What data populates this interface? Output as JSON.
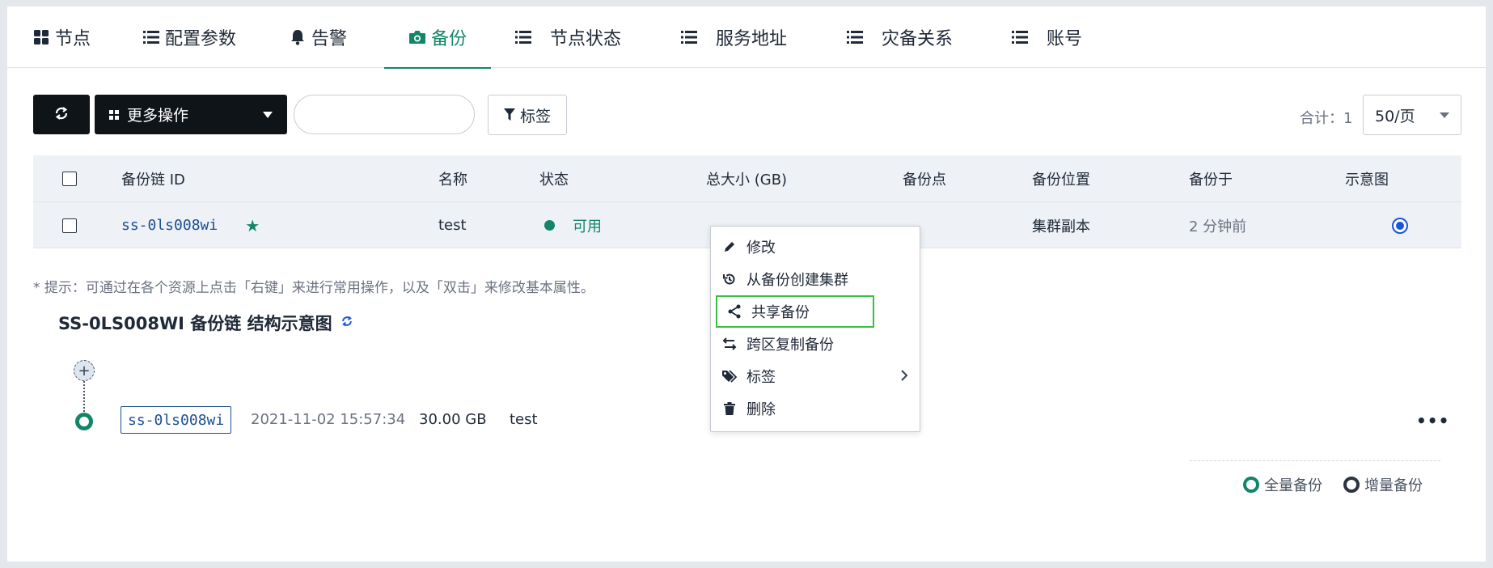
{
  "tabs": [
    {
      "label": "节点",
      "icon": "grid-icon"
    },
    {
      "label": "配置参数",
      "icon": "list-icon"
    },
    {
      "label": "告警",
      "icon": "bell-icon"
    },
    {
      "label": "备份",
      "icon": "camera-icon",
      "active": true
    },
    {
      "label": "节点状态",
      "icon": "list-icon"
    },
    {
      "label": "服务地址",
      "icon": "list-icon"
    },
    {
      "label": "灾备关系",
      "icon": "list-icon"
    },
    {
      "label": "账号",
      "icon": "list-icon"
    }
  ],
  "toolbar": {
    "more_actions_label": "更多操作",
    "search_placeholder": "",
    "tag_filter_label": "标签",
    "total_label": "合计：1",
    "page_size": "50/页"
  },
  "table": {
    "columns": [
      "备份链 ID",
      "名称",
      "状态",
      "总大小 (GB)",
      "备份点",
      "备份位置",
      "备份于",
      "示意图"
    ],
    "rows": [
      {
        "id": "ss-0ls008wi",
        "name": "test",
        "status": "可用",
        "total_size": "",
        "backup_points": "",
        "location": "集群副本",
        "backed_up": "2 分钟前"
      }
    ]
  },
  "hint": "* 提示：可通过在各个资源上点击「右键」来进行常用操作，以及「双击」来修改基本属性。",
  "diagram": {
    "title": "SS-0LS008WI 备份链 结构示意图",
    "node": {
      "id": "ss-0ls008wi",
      "time": "2021-11-02 15:57:34",
      "size": "30.00 GB",
      "name": "test"
    },
    "legend": {
      "full": "全量备份",
      "incremental": "增量备份"
    }
  },
  "context_menu": {
    "items": [
      {
        "label": "修改",
        "icon": "pencil-icon"
      },
      {
        "label": "从备份创建集群",
        "icon": "history-icon"
      },
      {
        "label": "共享备份",
        "icon": "share-icon",
        "highlighted": true
      },
      {
        "label": "跨区复制备份",
        "icon": "transfer-icon"
      },
      {
        "label": "标签",
        "icon": "tags-icon",
        "submenu": true
      },
      {
        "label": "删除",
        "icon": "trash-icon"
      }
    ]
  },
  "colors": {
    "accent": "#13866a",
    "link": "#1d4f91",
    "highlight_border": "#36c03d"
  }
}
